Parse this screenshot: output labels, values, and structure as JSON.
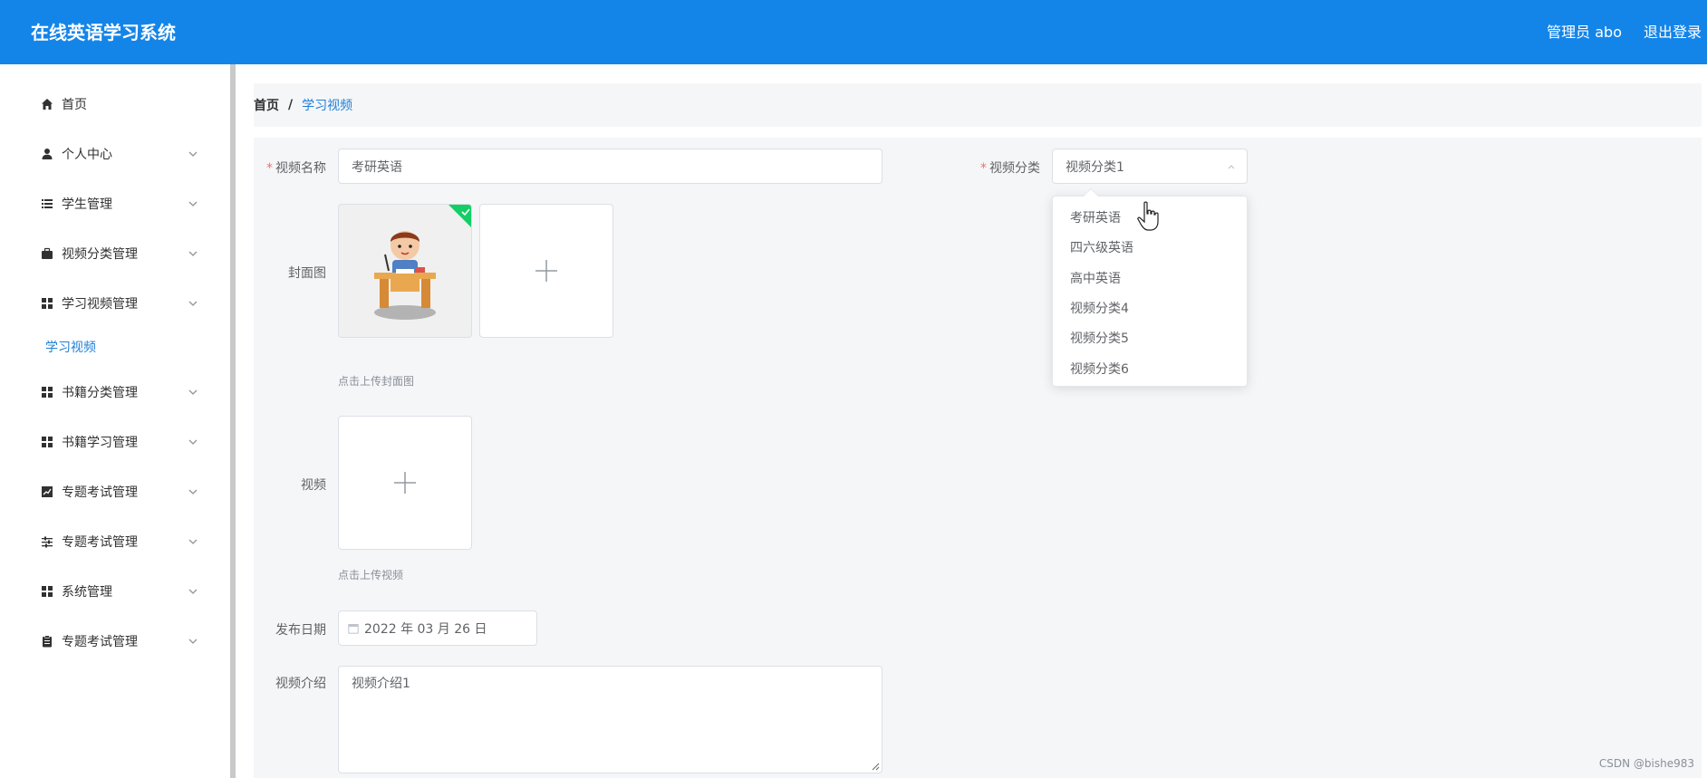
{
  "header": {
    "brand": "在线英语学习系统",
    "user": "管理员 abo",
    "logout": "退出登录"
  },
  "sidebar": {
    "items": [
      {
        "label": "首页",
        "icon": "home-icon",
        "has_children": false
      },
      {
        "label": "个人中心",
        "icon": "user-icon",
        "has_children": true
      },
      {
        "label": "学生管理",
        "icon": "list-icon",
        "has_children": true
      },
      {
        "label": "视频分类管理",
        "icon": "briefcase-icon",
        "has_children": true
      },
      {
        "label": "学习视频管理",
        "icon": "grid-icon",
        "has_children": true
      },
      {
        "label": "书籍分类管理",
        "icon": "grid-icon",
        "has_children": true
      },
      {
        "label": "书籍学习管理",
        "icon": "grid-icon",
        "has_children": true
      },
      {
        "label": "专题考试管理",
        "icon": "chart-icon",
        "has_children": true
      },
      {
        "label": "专题考试管理",
        "icon": "sliders-icon",
        "has_children": true
      },
      {
        "label": "系统管理",
        "icon": "grid-icon",
        "has_children": true
      },
      {
        "label": "专题考试管理",
        "icon": "clipboard-icon",
        "has_children": true
      }
    ],
    "sub_item": "学习视频"
  },
  "breadcrumb": {
    "home": "首页",
    "separator": "/",
    "current": "学习视频"
  },
  "form": {
    "name_label": "视频名称",
    "name_value": "考研英语",
    "category_label": "视频分类",
    "category_value": "视频分类1",
    "cover_label": "封面图",
    "cover_hint": "点击上传封面图",
    "video_label": "视频",
    "video_hint": "点击上传视频",
    "date_label": "发布日期",
    "date_value": "2022 年 03 月 26 日",
    "intro_label": "视频介绍",
    "intro_value": "视频介绍1"
  },
  "dropdown": {
    "options": [
      "考研英语",
      "四六级英语",
      "高中英语",
      "视频分类4",
      "视频分类5",
      "视频分类6"
    ]
  },
  "watermark": "CSDN @bishe983",
  "colors": {
    "header": "#1485e8",
    "accent": "#1e7fd9",
    "required": "#f56c6c",
    "success": "#13ce66"
  }
}
